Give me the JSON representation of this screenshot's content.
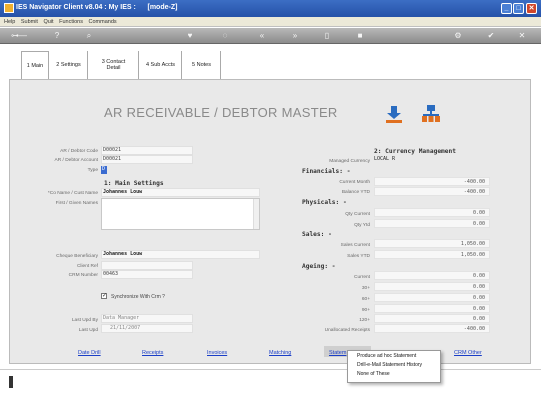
{
  "window": {
    "title": "IES Navigator Client v8.04 : My IES :      [mode-Z]",
    "min_label": "_",
    "max_label": "□",
    "close_label": "✕"
  },
  "menu": [
    "Help",
    "Submit",
    "Quit",
    "Functions",
    "Commands"
  ],
  "tabs": [
    {
      "label": "1 Main"
    },
    {
      "label": "2 Settings"
    },
    {
      "label": "3 Contact Detail"
    },
    {
      "label": "4 Sub Accts"
    },
    {
      "label": "5 Notes"
    }
  ],
  "header": {
    "title": "AR RECEIVABLE / DEBTOR MASTER"
  },
  "left": {
    "code_label": "AR / Debtor Code",
    "code_value": "D00021",
    "account_label": "AR / Debtor Account",
    "account_value": "D00021",
    "type_label": "Type",
    "type_value": "D",
    "section1": "1: Main Settings",
    "name_label": "*Co Name / Cust Name",
    "name_value": "Johannes Louw",
    "first_label": "First / Given Names",
    "cheque_label": "Cheque Beneficiary",
    "cheque_value": "Johannes Louw",
    "client_label": "Client Ref",
    "crm_label": "CRM Number",
    "crm_value": "00463",
    "sync_label": "Synchronize With Crm ?",
    "updby_label": "Last Upd By",
    "updby_value": "Data Manager",
    "upd_label": "Last Upd",
    "upd_value": "21/11/2007"
  },
  "right": {
    "section2": "2: Currency Management",
    "currency_label": "Managed Currency",
    "currency_value": "LOCAL R",
    "financials": "Financials: -",
    "cur_month_label": "Current Month",
    "cur_month": "-400.00",
    "bal_ytd_label": "Balance YTD",
    "bal_ytd": "-400.00",
    "physicals": "Physicals: -",
    "qty_cur_label": "Qty Current",
    "qty_cur": "0.00",
    "qty_ytd_label": "Qty Ytd",
    "qty_ytd": "0.00",
    "sales": "Sales: -",
    "sales_cur_label": "Sales Current",
    "sales_cur": "1,050.00",
    "sales_ytd_label": "Sales YTD",
    "sales_ytd": "1,050.00",
    "ageing": "Ageing: -",
    "age_current_label": "Current",
    "age_current": "0.00",
    "age_30_label": "30+",
    "age_30": "0.00",
    "age_60_label": "60+",
    "age_60": "0.00",
    "age_90_label": "90+",
    "age_90": "0.00",
    "age_120_label": "120+",
    "age_120": "0.00",
    "unalloc_label": "Unallocated Receipts",
    "unalloc": "-400.00"
  },
  "links": {
    "date_drill": "Date Drill",
    "receipts": "Receipts",
    "invoices": "Invoices",
    "matching": "Matching",
    "statem": "Statem",
    "crm_other": "CRM Other"
  },
  "popup": {
    "items": [
      "Produce ad hoc Statement",
      "Drill-e-Mail Statement History",
      "None of These"
    ]
  },
  "colors": {
    "accent": "#1a3ec7",
    "titlebar": "#2551a8",
    "icon_orange": "#e07020",
    "icon_blue": "#2a6cc0"
  }
}
